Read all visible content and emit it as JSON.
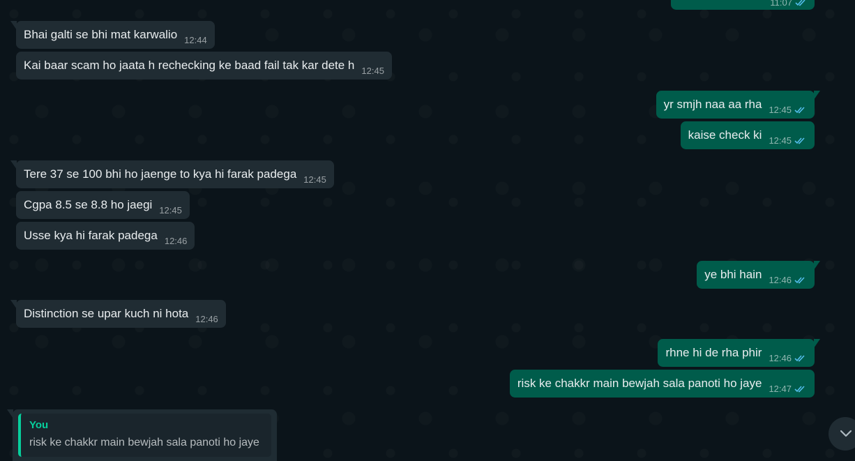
{
  "colors": {
    "background": "#0b141a",
    "incoming_bubble": "#202c33",
    "outgoing_bubble": "#005c4b",
    "text": "#e9edef",
    "read_ticks": "#53bdeb",
    "reply_accent": "#06cf9c"
  },
  "top_partial": {
    "time": "11:07",
    "status_icon": "double-check-icon"
  },
  "messages": [
    {
      "direction": "in",
      "text": "Bhai galti se bhi mat karwalio",
      "time": "12:44"
    },
    {
      "direction": "in",
      "text": "Kai baar scam ho jaata h rechecking ke baad fail tak kar dete h",
      "time": "12:45"
    },
    {
      "direction": "out",
      "text": "yr smjh naa aa rha",
      "time": "12:45",
      "status": "read"
    },
    {
      "direction": "out",
      "text": "kaise check ki",
      "time": "12:45",
      "status": "read"
    },
    {
      "direction": "in",
      "text": "Tere 37 se 100 bhi ho jaenge to kya hi farak padega",
      "time": "12:45"
    },
    {
      "direction": "in",
      "text": "Cgpa 8.5 se 8.8 ho jaegi",
      "time": "12:45"
    },
    {
      "direction": "in",
      "text": "Usse kya hi farak padega",
      "time": "12:46"
    },
    {
      "direction": "out",
      "text": "ye bhi hain",
      "time": "12:46",
      "status": "read"
    },
    {
      "direction": "in",
      "text": "Distinction se upar kuch ni hota",
      "time": "12:46"
    },
    {
      "direction": "out",
      "text": "rhne hi de rha phir",
      "time": "12:46",
      "status": "read"
    },
    {
      "direction": "out",
      "text": "risk ke chakkr main bewjah sala panoti ho jaye",
      "time": "12:47",
      "status": "read"
    }
  ],
  "reply_preview": {
    "author": "You",
    "text": "risk ke chakkr main bewjah sala panoti ho jaye"
  },
  "scroll_button": {
    "icon": "chevron-down-icon"
  }
}
